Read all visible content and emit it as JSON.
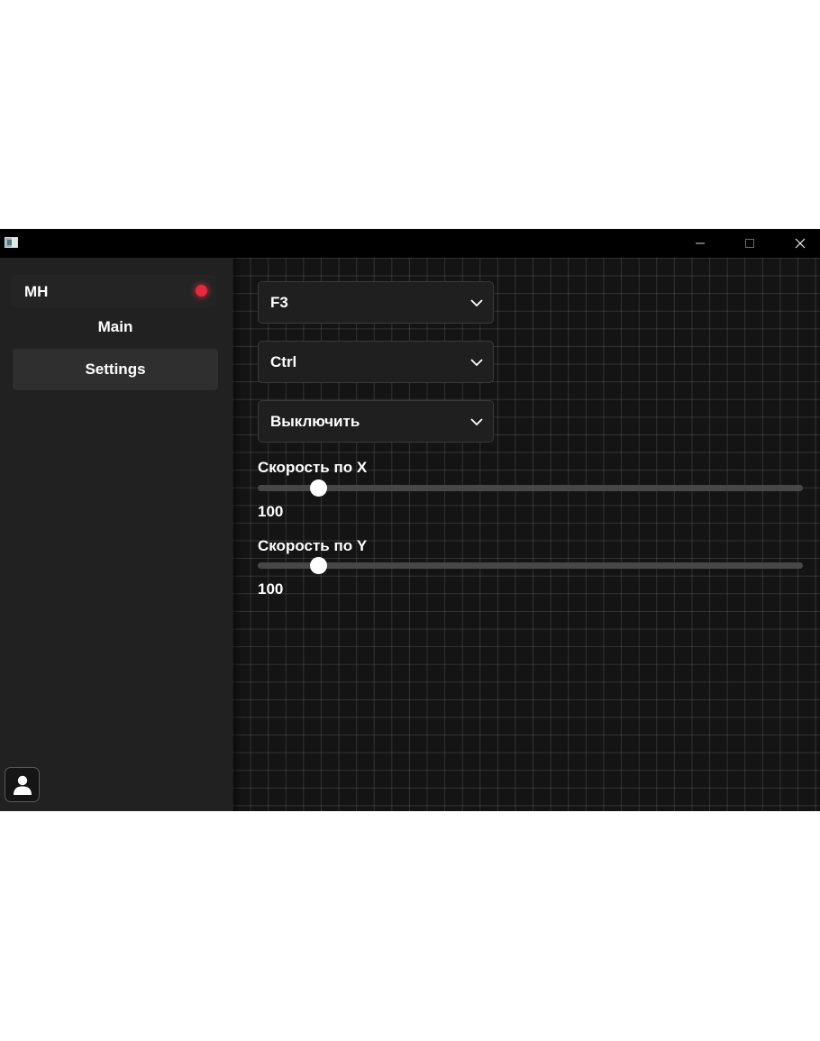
{
  "window": {
    "controls": {
      "minimize_icon": "minimize-icon",
      "maximize_icon": "maximize-icon",
      "close_icon": "close-icon"
    }
  },
  "sidebar": {
    "brand": "MH",
    "status_color": "#e8283c",
    "nav": [
      {
        "label": "Main",
        "active": false
      },
      {
        "label": "Settings",
        "active": true
      }
    ],
    "profile_icon": "user-icon"
  },
  "main": {
    "dropdowns": [
      {
        "value": "F3"
      },
      {
        "value": "Ctrl"
      },
      {
        "value": "Выключить"
      }
    ],
    "sliders": [
      {
        "label": "Скорость по X",
        "value": "100",
        "fraction": 0.11
      },
      {
        "label": "Скорость по Y",
        "value": "100",
        "fraction": 0.11
      }
    ]
  }
}
